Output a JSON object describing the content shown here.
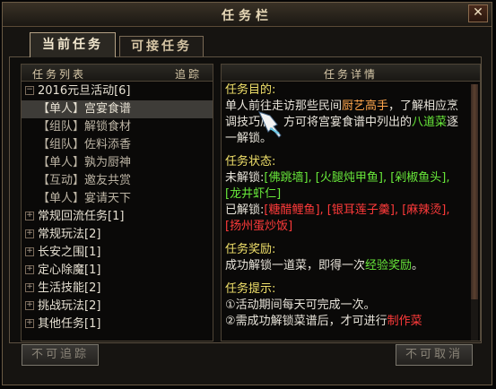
{
  "window": {
    "title": "任务栏",
    "close_label": "✕"
  },
  "tabs": [
    {
      "label": "当前任务"
    },
    {
      "label": "可接任务"
    }
  ],
  "left_panel": {
    "header_left": "任务列表",
    "header_right": "追踪",
    "group": {
      "label": "2016元旦活动[6]",
      "expander": "⊟"
    },
    "quests": [
      {
        "label": "【单人】宫宴食谱"
      },
      {
        "label": "【组队】解锁食材"
      },
      {
        "label": "【组队】佐料添香"
      },
      {
        "label": "【单人】孰为厨神"
      },
      {
        "label": "【互动】邀友共赏"
      },
      {
        "label": "【单人】宴请天下"
      }
    ],
    "categories": [
      {
        "label": "常规回流任务[1]"
      },
      {
        "label": "常规玩法[2]"
      },
      {
        "label": "长安之围[1]"
      },
      {
        "label": "定心除魔[1]"
      },
      {
        "label": "生活技能[2]"
      },
      {
        "label": "挑战玩法[2]"
      },
      {
        "label": "其他任务[1]"
      }
    ],
    "expander_collapsed": "+"
  },
  "right_panel": {
    "header": "任务详情",
    "goal_heading": "任务目的:",
    "goal_text_1": "单人前往走访那些民间",
    "goal_highlight": "厨艺高手",
    "goal_text_2": "，了解相应烹调技巧后，方可将宫宴食谱中列出的",
    "goal_highlight_2": "八道菜",
    "goal_text_3": "逐一解锁。",
    "status_heading": "任务状态:",
    "locked_label": "未解锁:",
    "locked_items": "[佛跳墙], [火腿炖甲鱼], [剁椒鱼头], [龙井虾仁]",
    "unlocked_label": "已解锁:",
    "unlocked_items": "[糖醋鲤鱼], [银耳莲子羹], [麻辣烫], [扬州蛋炒饭]",
    "reward_heading": "任务奖励:",
    "reward_text_1": "成功解锁一道菜，即得一次",
    "reward_highlight": "经验奖励",
    "reward_text_2": "。",
    "tips_heading": "任务提示:",
    "tip_1": "①活动期间每天可完成一次。",
    "tip_2_prefix": "②需成功解锁菜谱后，才可进行",
    "tip_2_highlight": "制作菜"
  },
  "buttons": {
    "untrack": "不可追踪",
    "cancel": "不可取消"
  }
}
